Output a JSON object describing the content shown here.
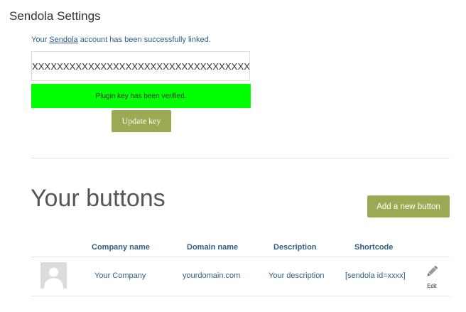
{
  "settings": {
    "title": "Sendola Settings",
    "linked_prefix": "Your ",
    "linked_link": "Sendola",
    "linked_suffix": " account has been successfully linked.",
    "key_value": "XXXXXXXXXXXXXXXXXXXXXXXXXXXXXXXXXXXX",
    "verified_message": "Plugin key has been verified.",
    "update_button_label": "Update key",
    "colors": {
      "accent": "#9aa952",
      "verified_bg": "#00ff00",
      "link": "#2f5f87"
    }
  },
  "buttons": {
    "heading": "Your buttons",
    "add_button_label": "Add a new button",
    "table": {
      "headers": [
        "Company name",
        "Domain name",
        "Description",
        "Shortcode"
      ],
      "rows": [
        {
          "avatar_icon": "user-placeholder-icon",
          "company": "Your Company",
          "domain": "yourdomain.com",
          "description": "Your description",
          "shortcode": "[sendola id=xxxx]",
          "edit_label": "Edit",
          "edit_icon": "pencil-icon"
        }
      ]
    }
  }
}
